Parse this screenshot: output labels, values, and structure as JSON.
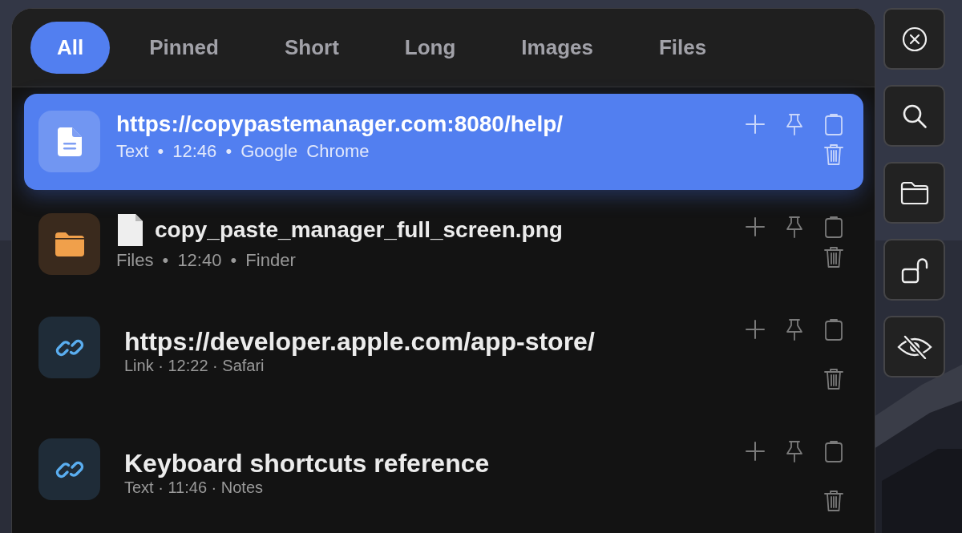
{
  "tabs": [
    {
      "label": "All",
      "selected": true
    },
    {
      "label": "Pinned",
      "selected": false
    },
    {
      "label": "Short",
      "selected": false
    },
    {
      "label": "Long",
      "selected": false
    },
    {
      "label": "Images",
      "selected": false
    },
    {
      "label": "Files",
      "selected": false
    }
  ],
  "items": [
    {
      "kind": "document",
      "selected": true,
      "file_badge": false,
      "title": "https://copypastemanager.com:8080/help/",
      "meta": "Text • 12:46 • Google Chrome"
    },
    {
      "kind": "folder",
      "selected": false,
      "file_badge": true,
      "title": "copy_paste_manager_full_screen.png",
      "meta": "Files • 12:40 • Finder"
    },
    {
      "kind": "link",
      "selected": false,
      "file_badge": false,
      "title": "https://developer.apple.com/app-store/",
      "meta": "Link · 12:22 · Safari"
    },
    {
      "kind": "link",
      "selected": false,
      "file_badge": false,
      "title": "Keyboard shortcuts reference",
      "meta": "Text · 11:46 · Notes"
    }
  ],
  "side_buttons": [
    {
      "kind": "close"
    },
    {
      "kind": "search"
    },
    {
      "kind": "folder"
    },
    {
      "kind": "unlock"
    },
    {
      "kind": "hide"
    }
  ]
}
